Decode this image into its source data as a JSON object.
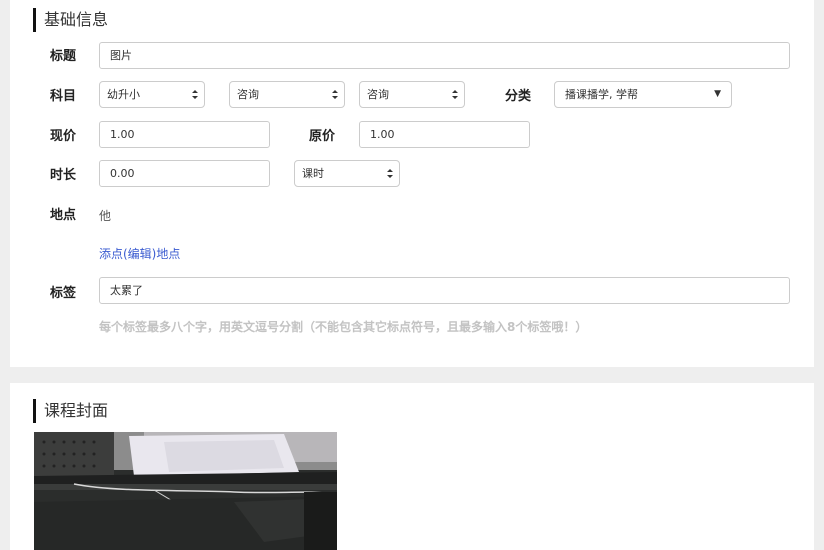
{
  "basic_info": {
    "section_title": "基础信息",
    "title_label": "标题",
    "title_value": "图片",
    "subject_label": "科目",
    "subject_select_1": "幼升小",
    "subject_select_2": "咨询",
    "subject_select_3": "咨询",
    "category_label": "分类",
    "category_value": "播课播学, 学帮",
    "current_price_label": "现价",
    "current_price_value": "1.00",
    "original_price_label": "原价",
    "original_price_value": "1.00",
    "duration_label": "时长",
    "duration_value": "0.00",
    "duration_unit": "课时",
    "location_label": "地点",
    "location_value": "他",
    "location_edit_link": "添点(编辑)地点",
    "tags_label": "标签",
    "tags_value": "太累了",
    "tags_hint": "每个标签最多八个字，用英文逗号分割（不能包含其它标点符号，且最多输入8个标签哦！）"
  },
  "cover": {
    "section_title": "课程封面"
  }
}
